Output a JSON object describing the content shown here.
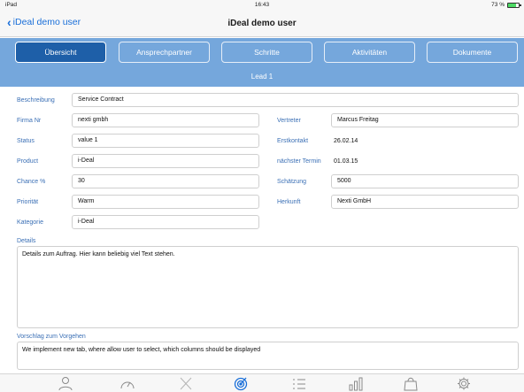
{
  "status_bar": {
    "device": "iPad",
    "wifi": "wifi-icon",
    "time": "16:43",
    "battery": "73 %",
    "battery_level": 0.73
  },
  "nav": {
    "back_label": "iDeal demo user",
    "title": "iDeal demo user"
  },
  "segments": [
    "Übersicht",
    "Ansprechpartner",
    "Schritte",
    "Aktivitäten",
    "Dokumente"
  ],
  "active_segment": 0,
  "section_title": "Lead 1",
  "form": {
    "beschreibung": {
      "label": "Beschreibung",
      "value": "Service Contract"
    },
    "firma_nr": {
      "label": "Firma Nr",
      "value": "nexti gmbh"
    },
    "status": {
      "label": "Status",
      "value": "value 1"
    },
    "product": {
      "label": "Product",
      "value": "i-Deal"
    },
    "chance": {
      "label": "Chance %",
      "value": "30"
    },
    "prioritaet": {
      "label": "Priorität",
      "value": "Warm"
    },
    "kategorie": {
      "label": "Kategorie",
      "value": "i-Deal"
    },
    "vertreter": {
      "label": "Vertreter",
      "value": "Marcus Freitag"
    },
    "erstkontakt": {
      "label": "Erstkontakt",
      "value": "26.02.14"
    },
    "naechster_termin": {
      "label": "nächster Termin",
      "value": "01.03.15"
    },
    "schaetzung": {
      "label": "Schätzung",
      "value": "5000"
    },
    "herkunft": {
      "label": "Herkunft",
      "value": "Nexti GmbH"
    },
    "details": {
      "label": "Details",
      "value": "Details zum Auftrag. Hier kann beliebig viel Text stehen."
    },
    "vorschlag": {
      "label": "Vorschlag zum Vorgehen",
      "value": "We implement new tab, where allow user to select, which columns should be displayed"
    }
  },
  "tabbar_icons": [
    "person-icon",
    "gauge-icon",
    "tools-icon",
    "target-icon",
    "checklist-icon",
    "chart-icon",
    "bag-icon",
    "gear-icon"
  ],
  "colors": {
    "accent": "#1a6fd9",
    "segment_bg": "#75a7dc",
    "segment_active": "#1e5fa8",
    "label": "#3a6fb5"
  }
}
